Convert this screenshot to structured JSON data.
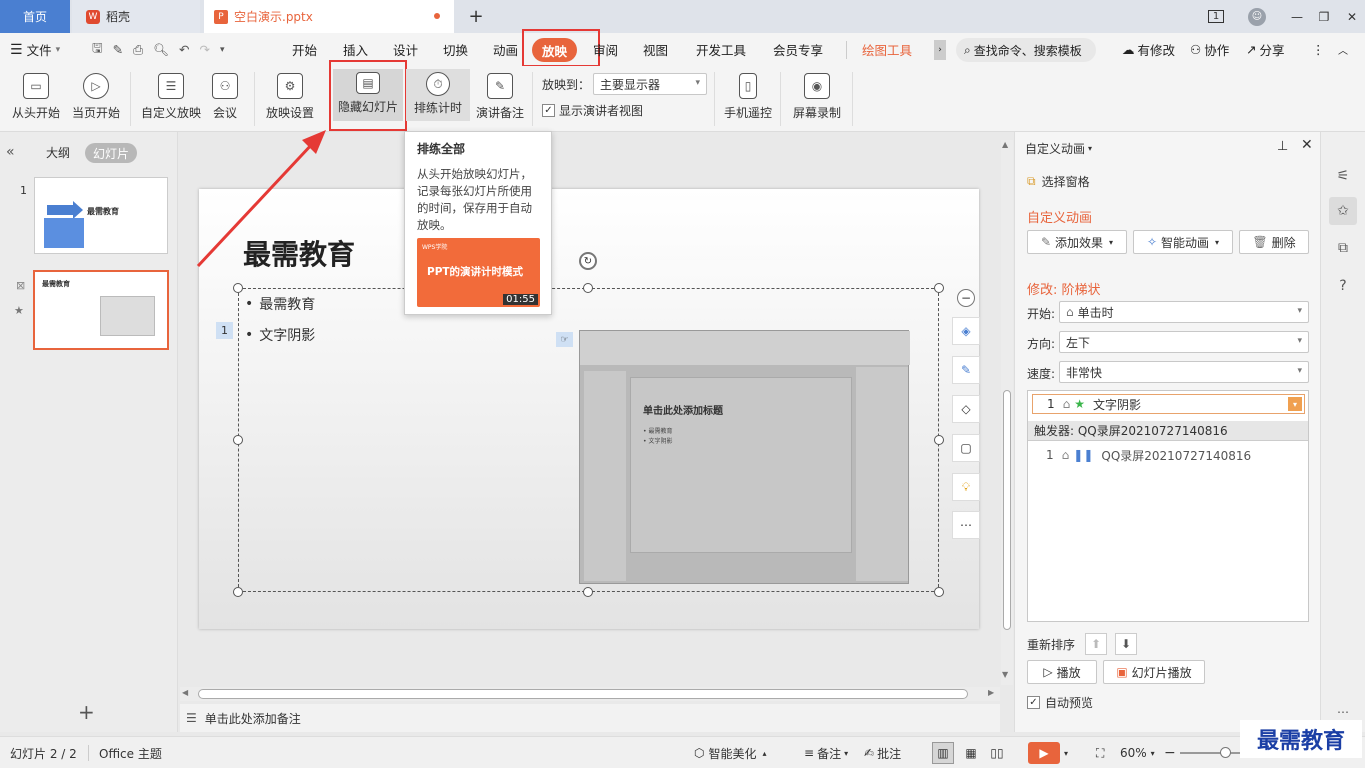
{
  "tabs": {
    "home": "首页",
    "wps": "稻壳",
    "doc": "空白演示.pptx",
    "add": "+"
  },
  "window": {
    "badge": "1",
    "minimize": "—",
    "restore": "❐",
    "close": "✕"
  },
  "menu": {
    "file": "文件",
    "items": [
      "开始",
      "插入",
      "设计",
      "切换",
      "动画",
      "放映",
      "审阅",
      "视图",
      "开发工具",
      "会员专享"
    ],
    "drawing_tools": "绘图工具",
    "search": "查找命令、搜索模板",
    "edit_status": "有修改",
    "collab": "协作",
    "share": "分享"
  },
  "ribbon": {
    "from_start": "从头开始",
    "from_current": "当页开始",
    "custom_show": "自定义放映",
    "meeting": "会议",
    "show_settings": "放映设置",
    "hide_slide": "隐藏幻灯片",
    "rehearse": "排练计时",
    "speaker_notes": "演讲备注",
    "show_to_label": "放映到：",
    "show_to_value": "主要显示器",
    "presenter_view": "显示演讲者视图",
    "phone_remote": "手机遥控",
    "screen_record": "屏幕录制"
  },
  "tooltip": {
    "title": "排练全部",
    "body": "从头开始放映幻灯片，记录每张幻灯片所使用的时间，保存用于自动放映。",
    "thumb_brand": "WPS学院",
    "thumb_title": "PPT的演讲计时模式",
    "duration": "01:55"
  },
  "leftpanel": {
    "outline": "大纲",
    "slides": "幻灯片",
    "slide1_num": "1",
    "slide1_title": "最需教育",
    "slide2_num": "2",
    "slide2_title": "最需教育",
    "add": "+"
  },
  "slide": {
    "title": "最需教育",
    "bullet1": "最需教育",
    "bullet2": "文字阴影",
    "anim_tag": "1",
    "inner_title": "单击此处添加标题",
    "inner_b1": "• 最需教育",
    "inner_b2": "• 文字阴影"
  },
  "notes": {
    "placeholder": "单击此处添加备注"
  },
  "rightpanel": {
    "header": "自定义动画",
    "select_pane": "选择窗格",
    "section": "自定义动画",
    "add_effect": "添加效果",
    "smart_anim": "智能动画",
    "delete": "删除",
    "modify": "修改: 阶梯状",
    "start_label": "开始:",
    "start_value": "单击时",
    "direction_label": "方向:",
    "direction_value": "左下",
    "speed_label": "速度:",
    "speed_value": "非常快",
    "item1_num": "1",
    "item1_name": "文字阴影",
    "trigger": "触发器: QQ录屏20210727140816",
    "item2_num": "1",
    "item2_name": "QQ录屏20210727140816",
    "reorder": "重新排序",
    "play": "播放",
    "slideshow": "幻灯片播放",
    "autopreview": "自动预览"
  },
  "statusbar": {
    "slide_info": "幻灯片 2 / 2",
    "theme": "Office 主题",
    "beautify": "智能美化",
    "notes": "备注",
    "comments": "批注",
    "zoom": "60%"
  },
  "watermark": "最需教育",
  "colors": {
    "accent": "#e8643c",
    "highlight": "#e53935",
    "tabbar": "#dfe3ea"
  }
}
